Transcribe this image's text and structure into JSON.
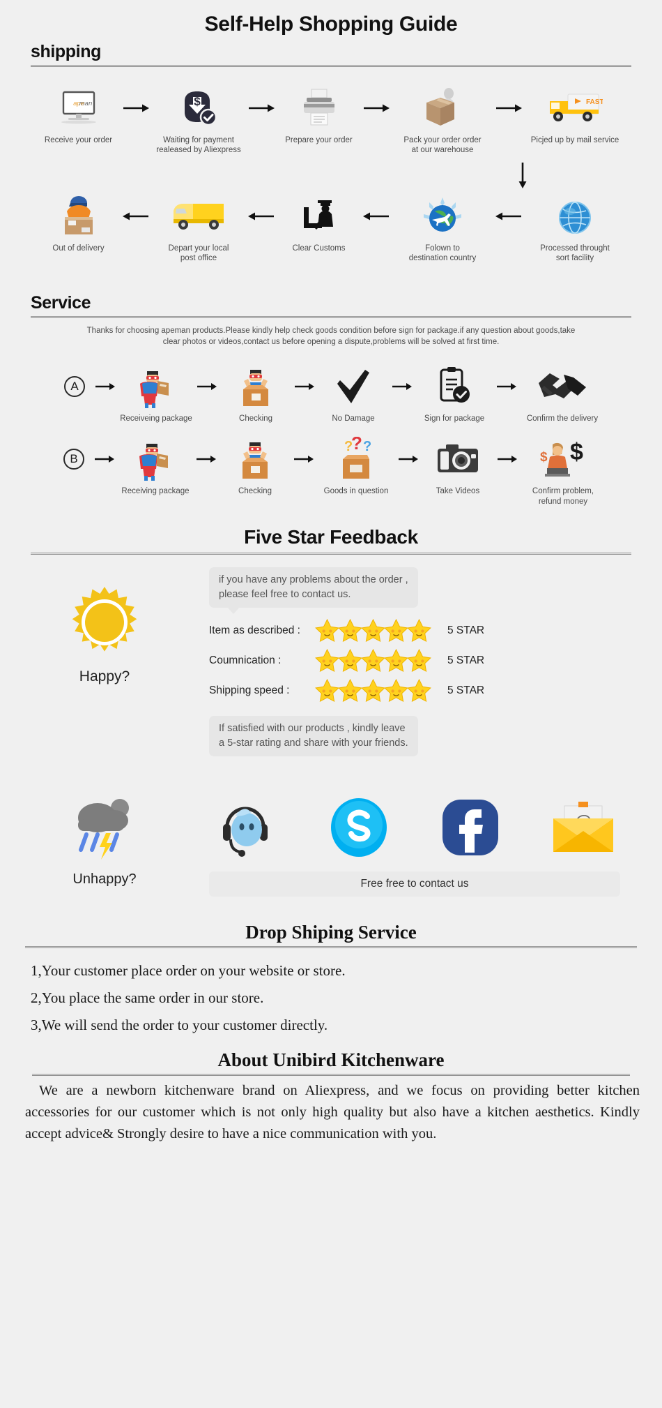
{
  "page": {
    "main_title": "Self-Help Shopping Guide",
    "background_color": "#f0f0f0"
  },
  "shipping": {
    "heading": "shipping",
    "row1": [
      {
        "label": "Receive your order",
        "icon": "monitor-apeman-icon"
      },
      {
        "label": "Waiting for payment\nrealeased by Aliexpress",
        "icon": "payment-dollar-icon"
      },
      {
        "label": "Prepare your order",
        "icon": "printer-icon"
      },
      {
        "label": "Pack your order order\nat our warehouse",
        "icon": "packing-box-icon"
      },
      {
        "label": "Picjed up by mail service",
        "icon": "delivery-truck-fast-icon"
      }
    ],
    "row2": [
      {
        "label": "Out of delivery",
        "icon": "courier-carrying-box-icon"
      },
      {
        "label": "Depart your local\npost office",
        "icon": "yellow-van-icon"
      },
      {
        "label": "Clear Customs",
        "icon": "customs-officer-icon"
      },
      {
        "label": "Folown to\ndestination country",
        "icon": "globe-airplane-icon"
      },
      {
        "label": "Processed throught\nsort facility",
        "icon": "globe-blue-icon"
      }
    ]
  },
  "service": {
    "heading": "Service",
    "note": "Thanks for choosing apeman products.Please kindly help check goods condition before sign for package.if any question about goods,take clear photos or videos,contact us before opening a dispute,problems will be solved at first time.",
    "row_a": {
      "badge": "A",
      "steps": [
        {
          "label": "Receiveing package",
          "icon": "hero-with-parcel-icon"
        },
        {
          "label": "Checking",
          "icon": "hero-opening-box-icon"
        },
        {
          "label": "No Damage",
          "icon": "check-mark-icon"
        },
        {
          "label": "Sign for package",
          "icon": "signed-document-icon"
        },
        {
          "label": "Confirm the delivery",
          "icon": "handshake-icon"
        }
      ]
    },
    "row_b": {
      "badge": "B",
      "steps": [
        {
          "label": "Receiving package",
          "icon": "hero-with-parcel-icon"
        },
        {
          "label": "Checking",
          "icon": "hero-opening-box-icon"
        },
        {
          "label": "Goods in question",
          "icon": "box-question-marks-icon"
        },
        {
          "label": "Take Videos",
          "icon": "camera-icon"
        },
        {
          "label": "Confirm problem,\nrefund money",
          "icon": "agent-refund-icon"
        }
      ]
    }
  },
  "feedback": {
    "title": "Five Star Feedback",
    "happy_label": "Happy?",
    "bubble_top": "if you have any problems about the order ,\nplease feel free to contact us.",
    "ratings": [
      {
        "label": "Item as described :",
        "stars": 5,
        "value": "5 STAR"
      },
      {
        "label": "Coumnication :",
        "stars": 5,
        "value": "5 STAR"
      },
      {
        "label": "Shipping speed :",
        "stars": 5,
        "value": "5 STAR"
      }
    ],
    "bubble_bottom": "If satisfied with our products ,  kindly leave\na 5-star rating and share with your friends.",
    "unhappy_label": "Unhappy?",
    "contact_bar": "Free free to contact us",
    "social_icons": [
      "live-chat-headset-icon",
      "skype-icon",
      "facebook-icon",
      "email-envelope-icon"
    ],
    "star_color": "#FFD21E",
    "sun_color": "#F3C218"
  },
  "dropship": {
    "title": "Drop Shiping Service",
    "items": [
      "1,Your customer place order on your website or store.",
      "2,You place the same order in our store.",
      "3,We will send the order to your customer directly."
    ]
  },
  "about": {
    "title": "About Unibird Kitchenware",
    "paragraph": "We are a newborn kitchenware brand on Aliexpress, and we focus on providing better kitchen accessories for our customer which is not only high quality but also have a kitchen aesthetics. Kindly accept advice& Strongly desire to have a nice communication with you."
  }
}
